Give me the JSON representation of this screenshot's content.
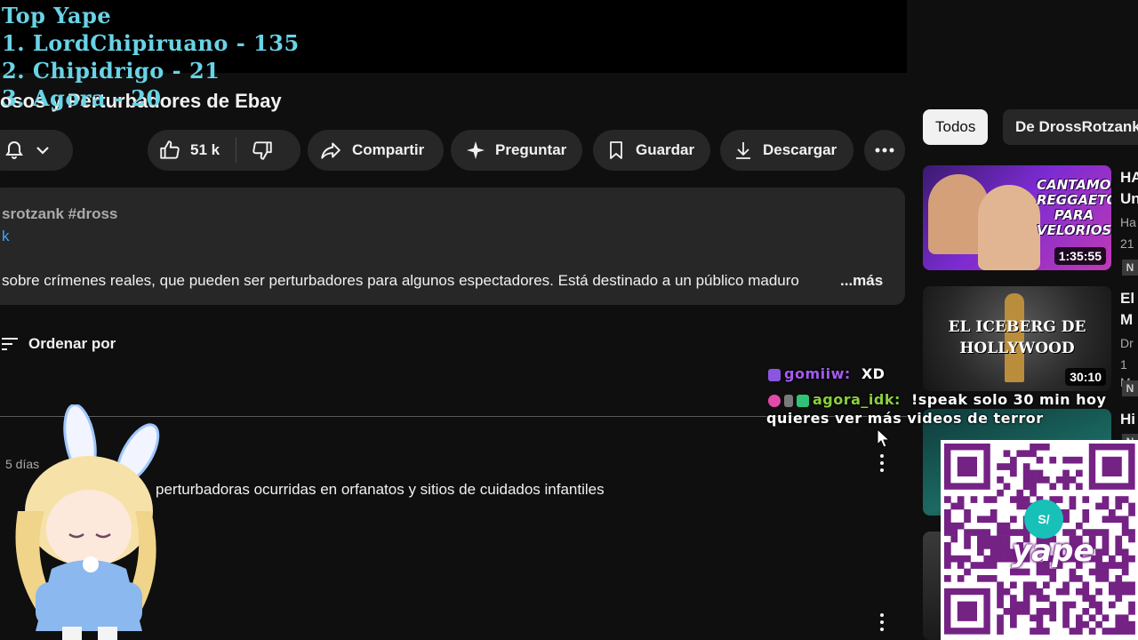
{
  "overlay": {
    "title": "Top Yape",
    "ranking": [
      "1. LordChipiruano - 135",
      "2. Chipidrigo - 21",
      "3. Agora - 20"
    ]
  },
  "video": {
    "title": "osos y Perturbadores de Ebay"
  },
  "actions": {
    "likes": "51 k",
    "share": "Compartir",
    "ask": "Preguntar",
    "save": "Guardar",
    "download": "Descargar"
  },
  "description": {
    "tags": "srotzank #dross",
    "link": "k",
    "text": "sobre crímenes reales, que pueden ser perturbadores para algunos espectadores. Está destinado a un público maduro",
    "more": "...más"
  },
  "comments": {
    "sort_label": "Ordenar por",
    "first": {
      "date": "5 días",
      "text": "perturbadoras ocurridas en orfanatos y sitios de cuidados infantiles"
    }
  },
  "sidebar": {
    "chips": [
      "Todos",
      "De DrossRotzank"
    ],
    "videos": [
      {
        "thumb_title": "CANTAMOS REGGAETON PARA VELORIOS",
        "duration": "1:35:55",
        "title_lines": [
          "HA",
          "Un"
        ],
        "meta": [
          "Ha",
          "21"
        ],
        "badge": "N"
      },
      {
        "thumb_title": "EL ICEBERG DE HOLLYWOOD",
        "duration": "30:10",
        "title_lines": [
          "El",
          "M"
        ],
        "meta": [
          "Dr",
          "1 M"
        ],
        "badge": "N"
      },
      {
        "title_lines": [
          "Hi"
        ],
        "badge": "N"
      }
    ]
  },
  "chat": [
    {
      "user": "gomiiw:",
      "message": "XD",
      "user_color": "#a35bf2"
    },
    {
      "user": "agora_idk:",
      "message": "!speak solo 30 min hoy",
      "continuation": "quieres ver más videos de terror",
      "user_color": "#8bd13a"
    }
  ],
  "qr": {
    "brand": "yape",
    "logo_text": "S/"
  },
  "colors": {
    "background": "#0f0f0f",
    "pill": "#272727",
    "overlay_text": "#69d3e6",
    "link": "#3ea6ff",
    "yape_purple": "#742284"
  }
}
